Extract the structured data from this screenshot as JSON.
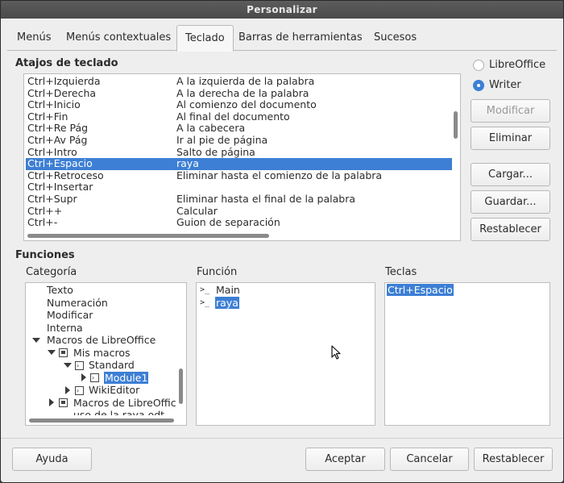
{
  "window": {
    "title": "Personalizar"
  },
  "tabs": [
    "Menús",
    "Menús contextuales",
    "Teclado",
    "Barras de herramientas",
    "Sucesos"
  ],
  "shortcuts": {
    "heading": "Atajos de teclado",
    "rows": [
      {
        "key": "Ctrl+Izquierda",
        "cmd": "A la izquierda de la palabra"
      },
      {
        "key": "Ctrl+Derecha",
        "cmd": "A la derecha de la palabra"
      },
      {
        "key": "Ctrl+Inicio",
        "cmd": "Al comienzo del documento"
      },
      {
        "key": "Ctrl+Fin",
        "cmd": "Al final del documento"
      },
      {
        "key": "Ctrl+Re Pág",
        "cmd": "A la cabecera"
      },
      {
        "key": "Ctrl+Av Pág",
        "cmd": "Ir al pie de página"
      },
      {
        "key": "Ctrl+Intro",
        "cmd": "Salto de página"
      },
      {
        "key": "Ctrl+Espacio",
        "cmd": "raya"
      },
      {
        "key": "Ctrl+Retroceso",
        "cmd": "Eliminar hasta el comienzo de la palabra"
      },
      {
        "key": "Ctrl+Insertar",
        "cmd": ""
      },
      {
        "key": "Ctrl+Supr",
        "cmd": "Eliminar hasta el final de la palabra"
      },
      {
        "key": "Ctrl++",
        "cmd": "Calcular"
      },
      {
        "key": "Ctrl+-",
        "cmd": "Guion de separación"
      }
    ],
    "selected_key": "Ctrl+Espacio"
  },
  "scope": {
    "options": [
      "LibreOffice",
      "Writer"
    ],
    "selected": "Writer"
  },
  "side_buttons": {
    "modificar": "Modificar",
    "eliminar": "Eliminar",
    "cargar": "Cargar...",
    "guardar": "Guardar...",
    "restablecer": "Restablecer"
  },
  "functions": {
    "heading": "Funciones",
    "category_label": "Categoría",
    "function_label": "Función",
    "keys_label": "Teclas",
    "categories": {
      "texto": "Texto",
      "numeracion": "Numeración",
      "modificar": "Modificar",
      "interna": "Interna",
      "macros_lo": "Macros de LibreOffice",
      "mis_macros": "Mis macros",
      "standard": "Standard",
      "module1": "Module1",
      "wikieditor": "WikiEditor",
      "macros_lo2": "Macros de LibreOffic",
      "doc": "uso de la raya.odt"
    },
    "function_items": [
      "Main",
      "raya"
    ],
    "selected_function": "raya",
    "keys": [
      "Ctrl+Espacio"
    ]
  },
  "footer": {
    "ayuda": "Ayuda",
    "aceptar": "Aceptar",
    "cancelar": "Cancelar",
    "restablecer": "Restablecer"
  },
  "colors": {
    "selection": "#3d7fd4",
    "titlebar": "#4a4a4a"
  }
}
